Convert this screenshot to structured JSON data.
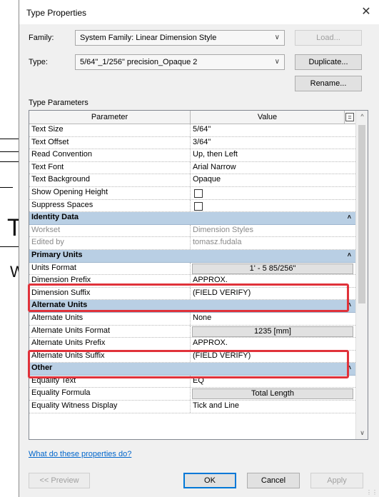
{
  "window": {
    "title": "Type Properties",
    "close_symbol": "✕"
  },
  "background": {
    "glyph_t": "T",
    "glyph_w": "W"
  },
  "family": {
    "label": "Family:",
    "value": "System Family: Linear Dimension Style",
    "load_label": "Load..."
  },
  "type": {
    "label": "Type:",
    "value": "5/64\"_1/256\" precision_Opaque 2",
    "duplicate_label": "Duplicate...",
    "rename_label": "Rename..."
  },
  "section_label": "Type Parameters",
  "grid": {
    "col_parameter": "Parameter",
    "col_value": "Value",
    "rows": [
      {
        "kind": "param",
        "p": "Text Size",
        "v": "5/64\""
      },
      {
        "kind": "param",
        "p": "Text Offset",
        "v": "3/64\""
      },
      {
        "kind": "param",
        "p": "Read Convention",
        "v": "Up, then Left"
      },
      {
        "kind": "param",
        "p": "Text Font",
        "v": "Arial Narrow"
      },
      {
        "kind": "param",
        "p": "Text Background",
        "v": "Opaque"
      },
      {
        "kind": "check",
        "p": "Show Opening Height",
        "v": ""
      },
      {
        "kind": "check",
        "p": "Suppress Spaces",
        "v": ""
      },
      {
        "kind": "group",
        "p": "Identity Data",
        "v": ""
      },
      {
        "kind": "readonly",
        "p": "Workset",
        "v": "Dimension Styles"
      },
      {
        "kind": "readonly",
        "p": "Edited by",
        "v": "tomasz.fudala"
      },
      {
        "kind": "group",
        "p": "Primary Units",
        "v": ""
      },
      {
        "kind": "button",
        "p": "Units Format",
        "v": "1' - 5 85/256\""
      },
      {
        "kind": "param",
        "p": "Dimension Prefix",
        "v": "APPROX."
      },
      {
        "kind": "param",
        "p": "Dimension Suffix",
        "v": "(FIELD VERIFY)"
      },
      {
        "kind": "group",
        "p": "Alternate Units",
        "v": ""
      },
      {
        "kind": "param",
        "p": "Alternate Units",
        "v": "None"
      },
      {
        "kind": "button",
        "p": "Alternate Units Format",
        "v": "1235 [mm]"
      },
      {
        "kind": "param",
        "p": "Alternate Units Prefix",
        "v": "APPROX."
      },
      {
        "kind": "param",
        "p": "Alternate Units Suffix",
        "v": "(FIELD VERIFY)"
      },
      {
        "kind": "group",
        "p": "Other",
        "v": ""
      },
      {
        "kind": "param",
        "p": "Equality Text",
        "v": "EQ"
      },
      {
        "kind": "button",
        "p": "Equality Formula",
        "v": "Total Length"
      },
      {
        "kind": "param",
        "p": "Equality Witness Display",
        "v": "Tick and Line"
      }
    ]
  },
  "help_link": "What do these properties do?",
  "footer": {
    "preview": "<< Preview",
    "ok": "OK",
    "cancel": "Cancel",
    "apply": "Apply"
  },
  "colors": {
    "highlight": "#e0323a",
    "group_bg": "#b9cfe4",
    "link": "#0066cc"
  }
}
